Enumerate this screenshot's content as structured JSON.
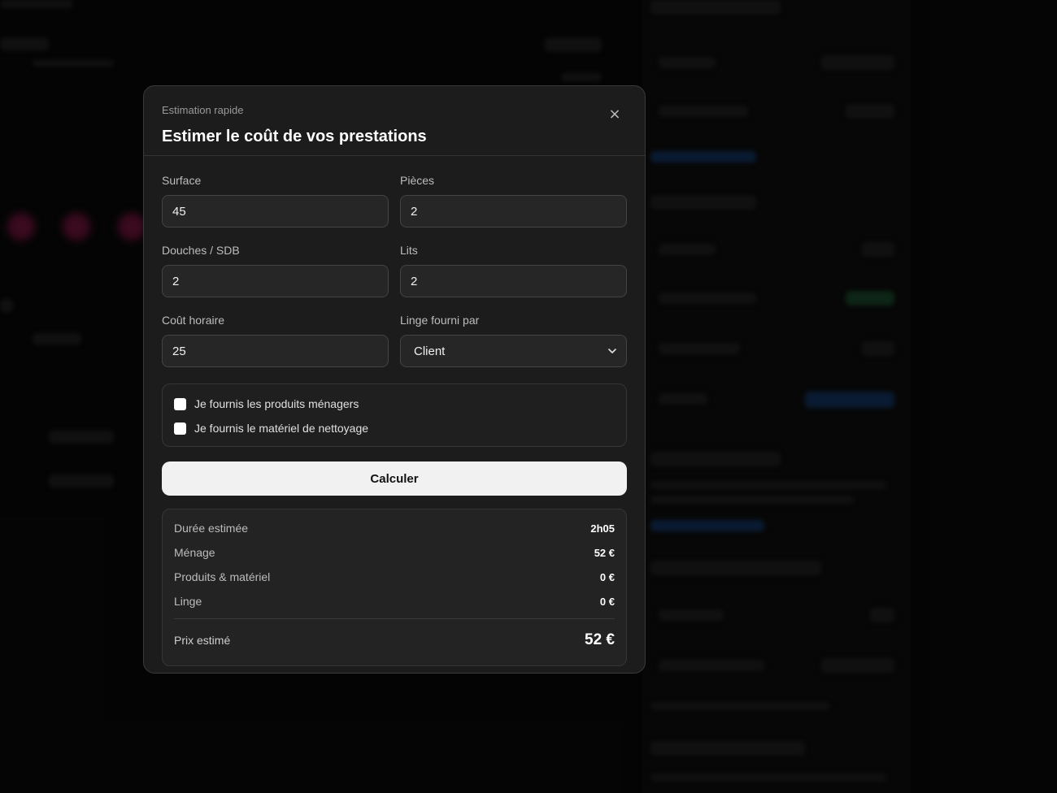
{
  "modal": {
    "eyebrow": "Estimation rapide",
    "title": "Estimer le coût de vos prestations",
    "close_glyph": "×"
  },
  "form": {
    "surface": {
      "label": "Surface",
      "value": "45"
    },
    "pieces": {
      "label": "Pièces",
      "value": "2"
    },
    "douches": {
      "label": "Douches / SDB",
      "value": "2"
    },
    "lits": {
      "label": "Lits",
      "value": "2"
    },
    "cout_horaire": {
      "label": "Coût horaire",
      "value": "25"
    },
    "linge": {
      "label": "Linge fourni par",
      "selected": "Client"
    }
  },
  "options": {
    "produits": {
      "label": "Je fournis les produits ménagers",
      "checked": false
    },
    "materiel": {
      "label": "Je fournis le matériel de nettoyage",
      "checked": false
    }
  },
  "calculate_label": "Calculer",
  "results": {
    "rows": [
      {
        "label": "Durée estimée",
        "value": "2h05"
      },
      {
        "label": "Ménage",
        "value": "52 €"
      },
      {
        "label": "Produits & matériel",
        "value": "0 €"
      },
      {
        "label": "Linge",
        "value": "0 €"
      }
    ],
    "total": {
      "label": "Prix estimé",
      "value": "52 €"
    }
  },
  "icons": {
    "close": "close-icon",
    "chevron": "chevron-down-icon",
    "checkbox": "checkbox-unchecked"
  },
  "colors": {
    "modal_bg": "#1c1c1c",
    "input_bg": "#262626",
    "button_bg": "#f1f1f1",
    "text_primary": "#ffffff"
  }
}
